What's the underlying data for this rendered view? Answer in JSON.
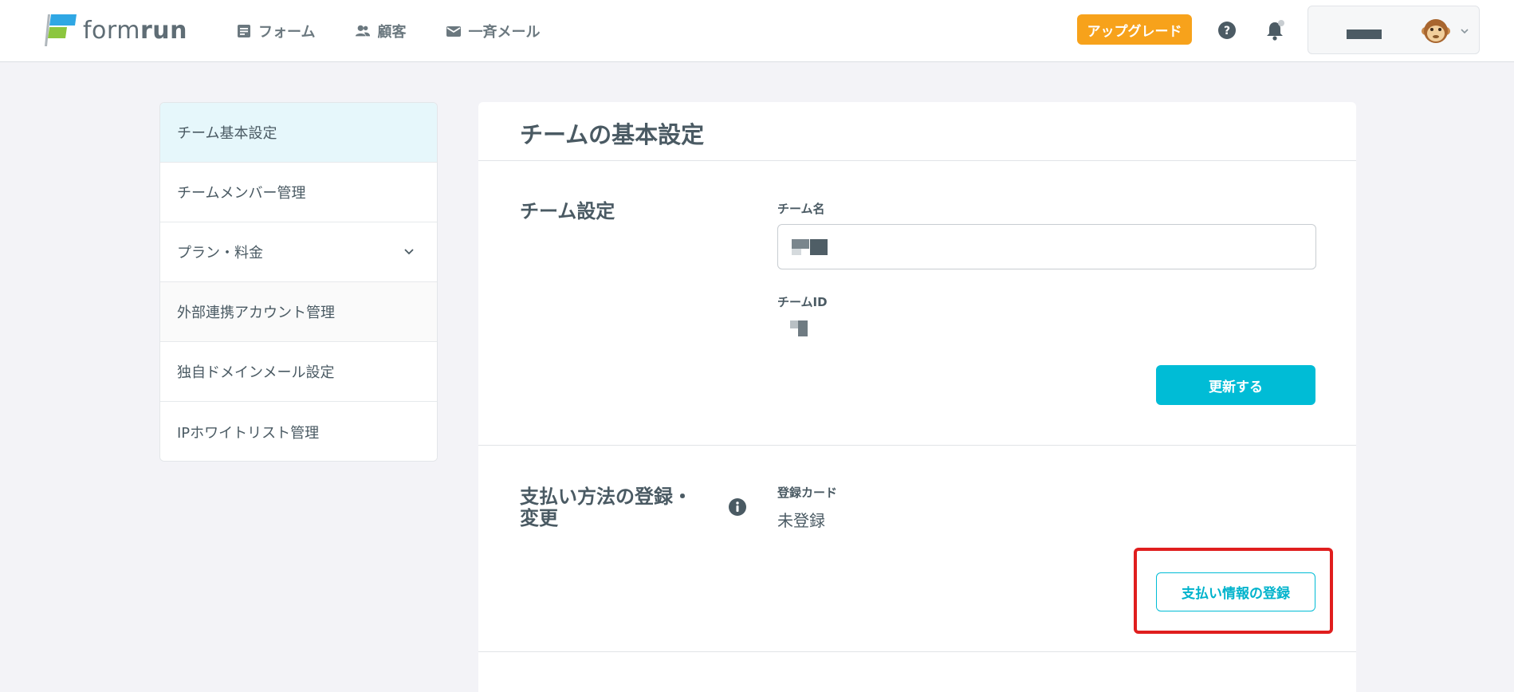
{
  "header": {
    "logo_text_light": "form",
    "logo_text_bold": "run",
    "nav": [
      {
        "label": "フォーム",
        "icon": "form-icon"
      },
      {
        "label": "顧客",
        "icon": "users-icon"
      },
      {
        "label": "一斉メール",
        "icon": "mail-icon"
      }
    ],
    "upgrade_label": "アップグレード"
  },
  "sidebar": {
    "items": [
      {
        "label": "チーム基本設定",
        "active": true
      },
      {
        "label": "チームメンバー管理"
      },
      {
        "label": "プラン・料金",
        "has_chevron": true
      },
      {
        "label": "外部連携アカウント管理"
      },
      {
        "label": "独自ドメインメール設定"
      },
      {
        "label": "IPホワイトリスト管理"
      }
    ]
  },
  "main": {
    "title": "チームの基本設定",
    "team_settings": {
      "heading": "チーム設定",
      "name_label": "チーム名",
      "id_label": "チームID",
      "update_button": "更新する"
    },
    "payment": {
      "heading_line1": "支払い方法の登録・",
      "heading_line2": "変更",
      "card_label": "登録カード",
      "card_value": "未登録",
      "register_button": "支払い情報の登録"
    }
  },
  "colors": {
    "accent": "#00bcd6",
    "upgrade": "#f7a21b",
    "highlight": "#e01e1e",
    "active_sidebar_bg": "#e6f7fb"
  }
}
